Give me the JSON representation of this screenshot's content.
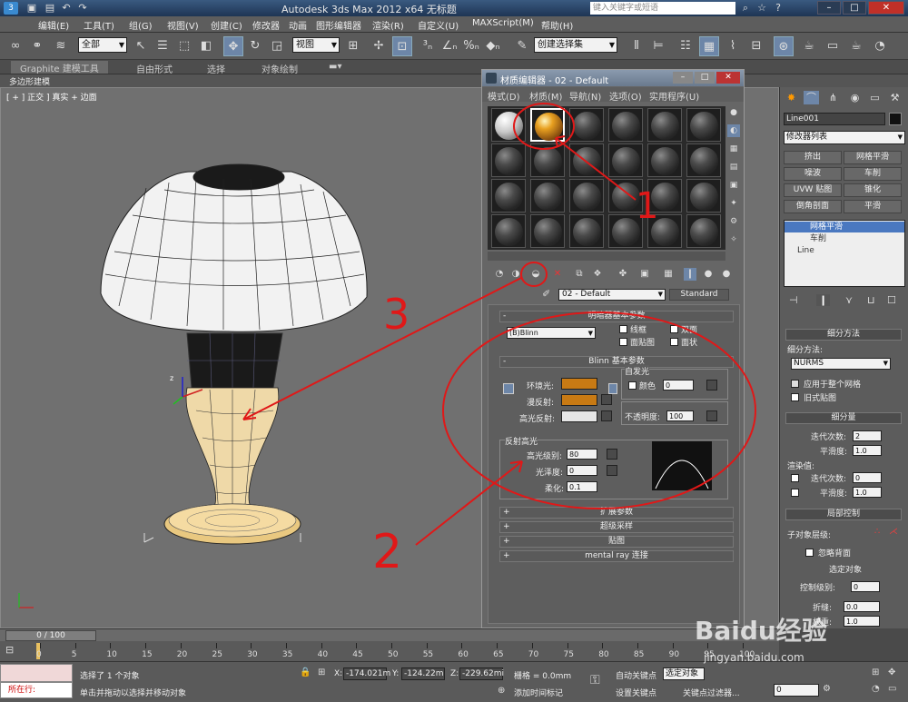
{
  "titlebar": {
    "app_title": "Autodesk 3ds Max  2012 x64     无标题",
    "search_placeholder": "键入关键字或短语"
  },
  "menubar": {
    "items": [
      "编辑(E)",
      "工具(T)",
      "组(G)",
      "视图(V)",
      "创建(C)",
      "修改器",
      "动画",
      "图形编辑器",
      "渲染(R)",
      "自定义(U)",
      "MAXScript(M)",
      "帮助(H)"
    ]
  },
  "toolbar": {
    "selection_filter": "全部",
    "ref_coord": "视图",
    "named_selection": "创建选择集"
  },
  "ribbon": {
    "tabs": [
      "Graphite 建模工具",
      "自由形式",
      "选择",
      "对象绘制"
    ],
    "sub_label": "多边形建模"
  },
  "viewport": {
    "label": "[ + ] 正交 ] 真实 + 边面"
  },
  "material_editor": {
    "title": "材质编辑器 - 02 - Default",
    "menu": [
      "模式(D)",
      "材质(M)",
      "导航(N)",
      "选项(O)",
      "实用程序(U)"
    ],
    "material_name": "02 - Default",
    "material_type": "Standard",
    "shader_rollout": "明暗器基本参数",
    "shader": "(B)Blinn",
    "shader_options": [
      "线框",
      "双面",
      "面贴图",
      "面状"
    ],
    "blinn_rollout": "Blinn 基本参数",
    "self_illum_group": "自发光",
    "ambient_label": "环境光:",
    "diffuse_label": "漫反射:",
    "specular_label": "高光反射:",
    "color_label": "颜色",
    "self_illum_value": "0",
    "opacity_label": "不透明度:",
    "opacity_value": "100",
    "specular_group": "反射高光",
    "spec_level_label": "高光级别:",
    "spec_level_value": "80",
    "glossiness_label": "光泽度:",
    "glossiness_value": "0",
    "soften_label": "柔化:",
    "soften_value": "0.1",
    "rollouts": [
      "扩展参数",
      "超级采样",
      "贴图",
      "mental ray 连接"
    ],
    "colors": {
      "ambient": "#c87a14",
      "diffuse": "#c87a14",
      "specular": "#e6e6e6"
    }
  },
  "command_panel": {
    "object_name": "Line001",
    "modifier_list": "修改器列表",
    "modifier_buttons": [
      "挤出",
      "网格平滑",
      "噪波",
      "车削",
      "UVW 贴图",
      "锥化",
      "倒角剖面",
      "平滑"
    ],
    "stack": [
      "网格平滑",
      "车削",
      "Line"
    ],
    "subdiv_method_rollout": "细分方法",
    "subdiv_method_label": "细分方法:",
    "subdiv_method_value": "NURMS",
    "apply_to_mesh": "应用于整个网格",
    "old_style": "旧式贴图",
    "subdiv_amount_rollout": "细分量",
    "iterations_label": "迭代次数:",
    "iterations_value": "2",
    "smoothness_label": "平滑度:",
    "smoothness_value": "1.0",
    "render_values_label": "渲染值:",
    "render_iterations_label": "迭代次数:",
    "render_iterations_value": "0",
    "render_smoothness_label": "平滑度:",
    "render_smoothness_value": "1.0",
    "local_control_rollout": "局部控制",
    "sub_object_level_label": "子对象层级:",
    "ignore_backface": "忽略背面",
    "selected_object": "选定对象",
    "control_level_label": "控制级别:",
    "control_level_value": "0",
    "crease_label": "折缝:",
    "crease_value": "0.0",
    "weight_label": "权重:",
    "weight_value": "1.0"
  },
  "timeline": {
    "slider": "0 / 100",
    "ticks": [
      "0",
      "5",
      "10",
      "15",
      "20",
      "25",
      "30",
      "35",
      "40",
      "45",
      "50",
      "55",
      "60",
      "65",
      "70",
      "75",
      "80",
      "85",
      "90",
      "95",
      "100"
    ]
  },
  "statusbar": {
    "script_label": "所在行:",
    "status1": "选择了 1 个对象",
    "status2": "单击并拖动以选择并移动对象",
    "x_label": "X:",
    "x_value": "-174.021m",
    "y_label": "Y:",
    "y_value": "-124.22m",
    "z_label": "Z:",
    "z_value": "-229.62mi",
    "grid": "栅格 = 0.0mm",
    "add_time_tag": "添加时间标记",
    "auto_key": "自动关键点",
    "set_key": "设置关键点",
    "selected": "选定对象",
    "key_filters": "关键点过滤器...",
    "frame": "0"
  },
  "annotations": [
    "1",
    "2",
    "3"
  ],
  "watermark": {
    "brand": "Baidu经验",
    "url": "jingyan.baidu.com"
  }
}
